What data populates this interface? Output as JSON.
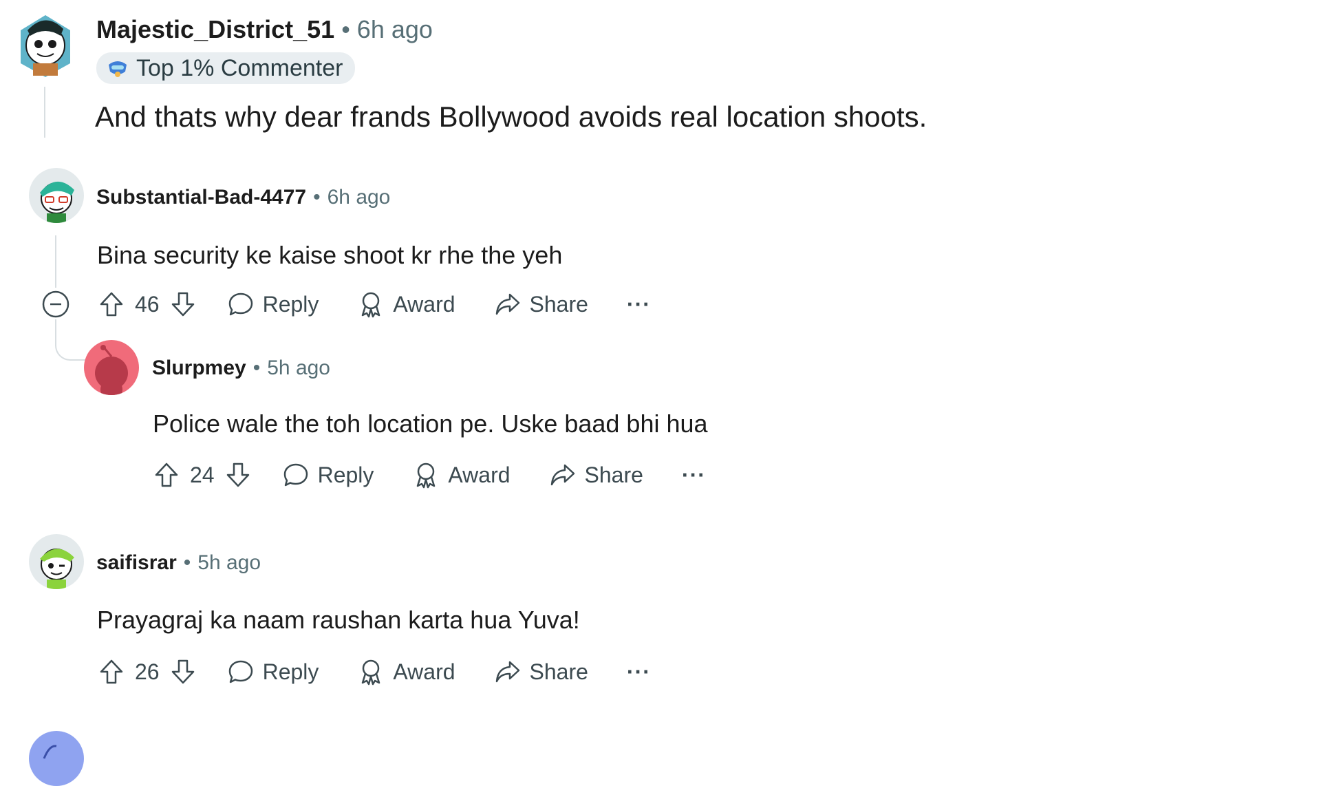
{
  "comments": [
    {
      "username": "Majestic_District_51",
      "time": "6h ago",
      "badge": "Top 1% Commenter",
      "body": "And thats why dear frands Bollywood avoids real location shoots."
    },
    {
      "username": "Substantial-Bad-4477",
      "time": "6h ago",
      "body": "Bina security ke kaise shoot kr rhe the yeh",
      "votes": "46",
      "reply_label": "Reply",
      "award_label": "Award",
      "share_label": "Share",
      "more_label": "···"
    },
    {
      "username": "Slurpmey",
      "time": "5h ago",
      "body": "Police wale the toh location pe. Uske baad bhi hua",
      "votes": "24",
      "reply_label": "Reply",
      "award_label": "Award",
      "share_label": "Share",
      "more_label": "···"
    },
    {
      "username": "saifisrar",
      "time": "5h ago",
      "body": "Prayagraj ka naam raushan karta hua Yuva!",
      "votes": "26",
      "reply_label": "Reply",
      "award_label": "Award",
      "share_label": "Share",
      "more_label": "···"
    }
  ],
  "separator": "•",
  "colors": {
    "text": "#1c1c1c",
    "muted": "#576f76",
    "badge_bg": "#e9eef1",
    "thread_line": "#d8dee1",
    "slurpmey_avatar": "#f06b7a"
  },
  "icons": [
    "upvote-icon",
    "downvote-icon",
    "reply-icon",
    "award-icon",
    "share-icon",
    "more-icon",
    "collapse-icon",
    "badge-icon"
  ]
}
